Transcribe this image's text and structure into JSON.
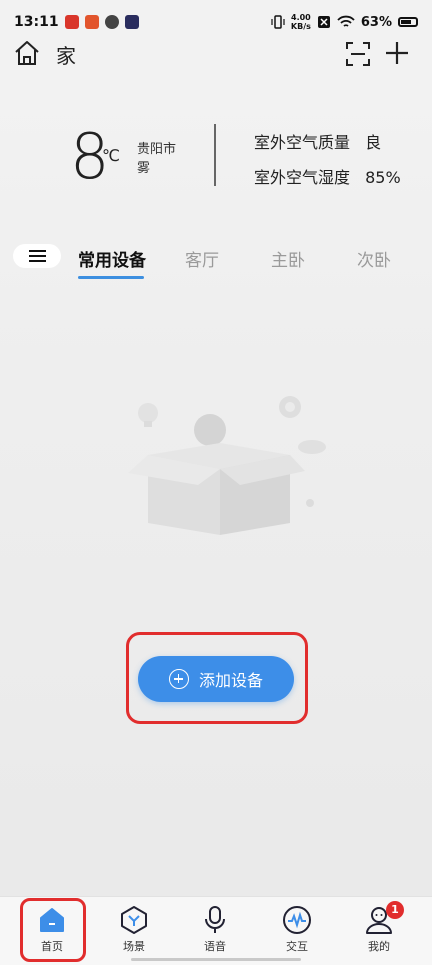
{
  "status_bar": {
    "time": "13:11",
    "net_speed_value": "4.00",
    "net_speed_unit": "KB/s",
    "battery_percent": "63%"
  },
  "header": {
    "home_name": "家"
  },
  "weather": {
    "temperature": "8",
    "unit": "℃",
    "city": "贵阳市",
    "condition": "雾",
    "air_quality_label": "室外空气质量",
    "air_quality_value": "良",
    "humidity_label": "室外空气湿度",
    "humidity_value": "85%"
  },
  "tabs": [
    {
      "label": "常用设备",
      "active": true
    },
    {
      "label": "客厅",
      "active": false
    },
    {
      "label": "主卧",
      "active": false
    },
    {
      "label": "次卧",
      "active": false
    }
  ],
  "main": {
    "add_device_label": "添加设备"
  },
  "bottom_nav": [
    {
      "label": "首页",
      "icon": "home-icon",
      "active": true
    },
    {
      "label": "场景",
      "icon": "scene-icon",
      "active": false
    },
    {
      "label": "语音",
      "icon": "microphone-icon",
      "active": false
    },
    {
      "label": "交互",
      "icon": "interaction-icon",
      "active": false
    },
    {
      "label": "我的",
      "icon": "profile-icon",
      "active": false,
      "badge": "1"
    }
  ],
  "colors": {
    "accent": "#3d8ee8",
    "highlight": "#e12d2d",
    "badge": "#e12d2d"
  }
}
